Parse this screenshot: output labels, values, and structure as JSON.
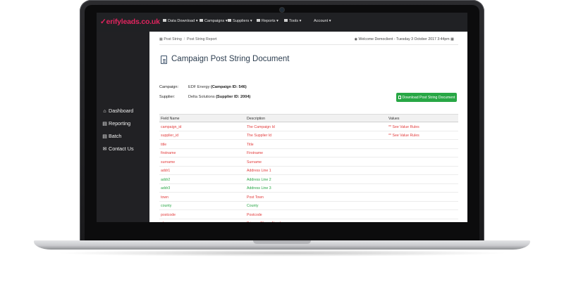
{
  "app": {
    "logo": "erifyleads.co.uk",
    "logo_mark": "✓"
  },
  "topnav": [
    {
      "label": "Data Download",
      "caret": "▾"
    },
    {
      "label": "Campaigns",
      "caret": "▾"
    },
    {
      "label": "Suppliers",
      "caret": "▾"
    },
    {
      "label": "Reports",
      "caret": "▾"
    },
    {
      "label": "Tools",
      "caret": "▾"
    },
    {
      "label": "Account",
      "caret": "▾"
    }
  ],
  "sidebar": {
    "items": [
      {
        "label": "Dashboard",
        "icon": "home-icon",
        "glyph": "⌂"
      },
      {
        "label": "Reporting",
        "icon": "file-icon",
        "glyph": "▤"
      },
      {
        "label": "Batch",
        "icon": "file-text-icon",
        "glyph": "▤"
      },
      {
        "label": "Contact Us",
        "icon": "chat-icon",
        "glyph": "✉"
      }
    ]
  },
  "breadcrumb": {
    "items": [
      "Post String",
      "Post String Report"
    ],
    "separator": "/"
  },
  "welcome": "Welcome Democlient - Tuesday 3 October 2017 3:44pm",
  "page": {
    "title": "Campaign Post String Document"
  },
  "campaign": {
    "label": "Campaign:",
    "name": "EDF Energy",
    "id_text": "(Campaign ID: 546)"
  },
  "supplier": {
    "label": "Supplier:",
    "name": "Delta Solutions",
    "id_text": "(Supplier ID: 2004)"
  },
  "download_button": "Download Post String Document",
  "table": {
    "headers": [
      "Field Name",
      "Description",
      "Values"
    ],
    "rows": [
      {
        "field": "campaign_id",
        "description": "The Campaign Id",
        "value": "** See Value Rules",
        "color": "red"
      },
      {
        "field": "supplier_id",
        "description": "The Supplier Id",
        "value": "** See Value Rules",
        "color": "red"
      },
      {
        "field": "title",
        "description": "Title",
        "value": "",
        "color": "red"
      },
      {
        "field": "firstname",
        "description": "Firstname",
        "value": "",
        "color": "red"
      },
      {
        "field": "surname",
        "description": "Surname",
        "value": "",
        "color": "red"
      },
      {
        "field": "addr1",
        "description": "Address Line 1",
        "value": "",
        "color": "red"
      },
      {
        "field": "addr2",
        "description": "Address Line 2",
        "value": "",
        "color": "green"
      },
      {
        "field": "addr3",
        "description": "Address Line 3",
        "value": "",
        "color": "green"
      },
      {
        "field": "town",
        "description": "Post Town",
        "value": "",
        "color": "red"
      },
      {
        "field": "county",
        "description": "County",
        "value": "",
        "color": "green"
      },
      {
        "field": "postcode",
        "description": "Postcode",
        "value": "",
        "color": "red"
      },
      {
        "field": "phone",
        "description": "Primary Phone Number",
        "value": "",
        "color": "red"
      }
    ]
  },
  "colors": {
    "required": "#e23c3c",
    "optional": "#27a645",
    "button": "#28a745",
    "logo": "#e0245e",
    "sidebar": "#212124"
  }
}
